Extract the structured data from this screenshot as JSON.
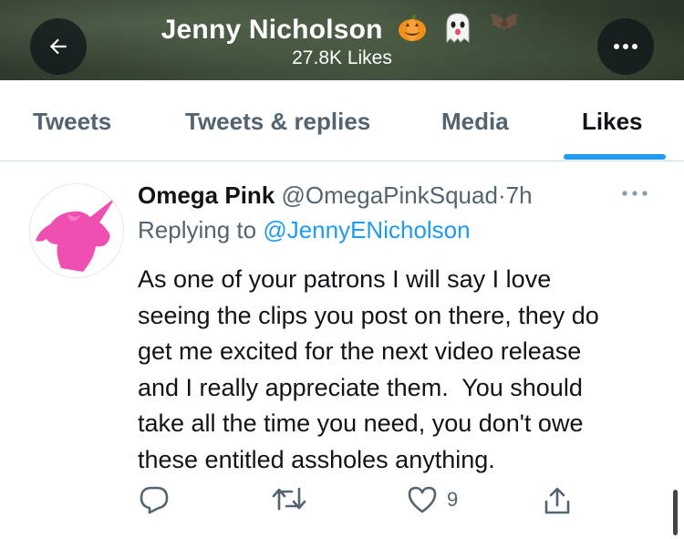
{
  "header": {
    "title": "Jenny Nicholson",
    "title_emojis": [
      "pumpkin-icon",
      "ghost-icon",
      "bat-icon"
    ],
    "subtitle": "27.8K Likes",
    "back_icon": "arrow-left-icon",
    "more_icon": "more-dots-icon"
  },
  "tabs": [
    {
      "label": "Tweets",
      "active": false
    },
    {
      "label": "Tweets & replies",
      "active": false
    },
    {
      "label": "Media",
      "active": false
    },
    {
      "label": "Likes",
      "active": true
    }
  ],
  "tweet": {
    "author_name": "Omega Pink",
    "author_handle": "@OmegaPinkSquad",
    "separator": "·",
    "time": "7h",
    "replying_prefix": "Replying to",
    "replying_to": "@JennyENicholson",
    "text_lines": [
      "As one of your patrons I will say I love",
      "seeing the clips you post on there, they do",
      "get me excited for the next video release",
      "and I really appreciate them.  You should",
      "take all the time you need, you don't owe",
      "these entitled assholes anything."
    ],
    "likes": "9",
    "avatar_color": "#ee4fb0"
  },
  "colors": {
    "accent": "#1d9bf0",
    "secondary_text": "#536471",
    "primary_text": "#0f1419"
  }
}
